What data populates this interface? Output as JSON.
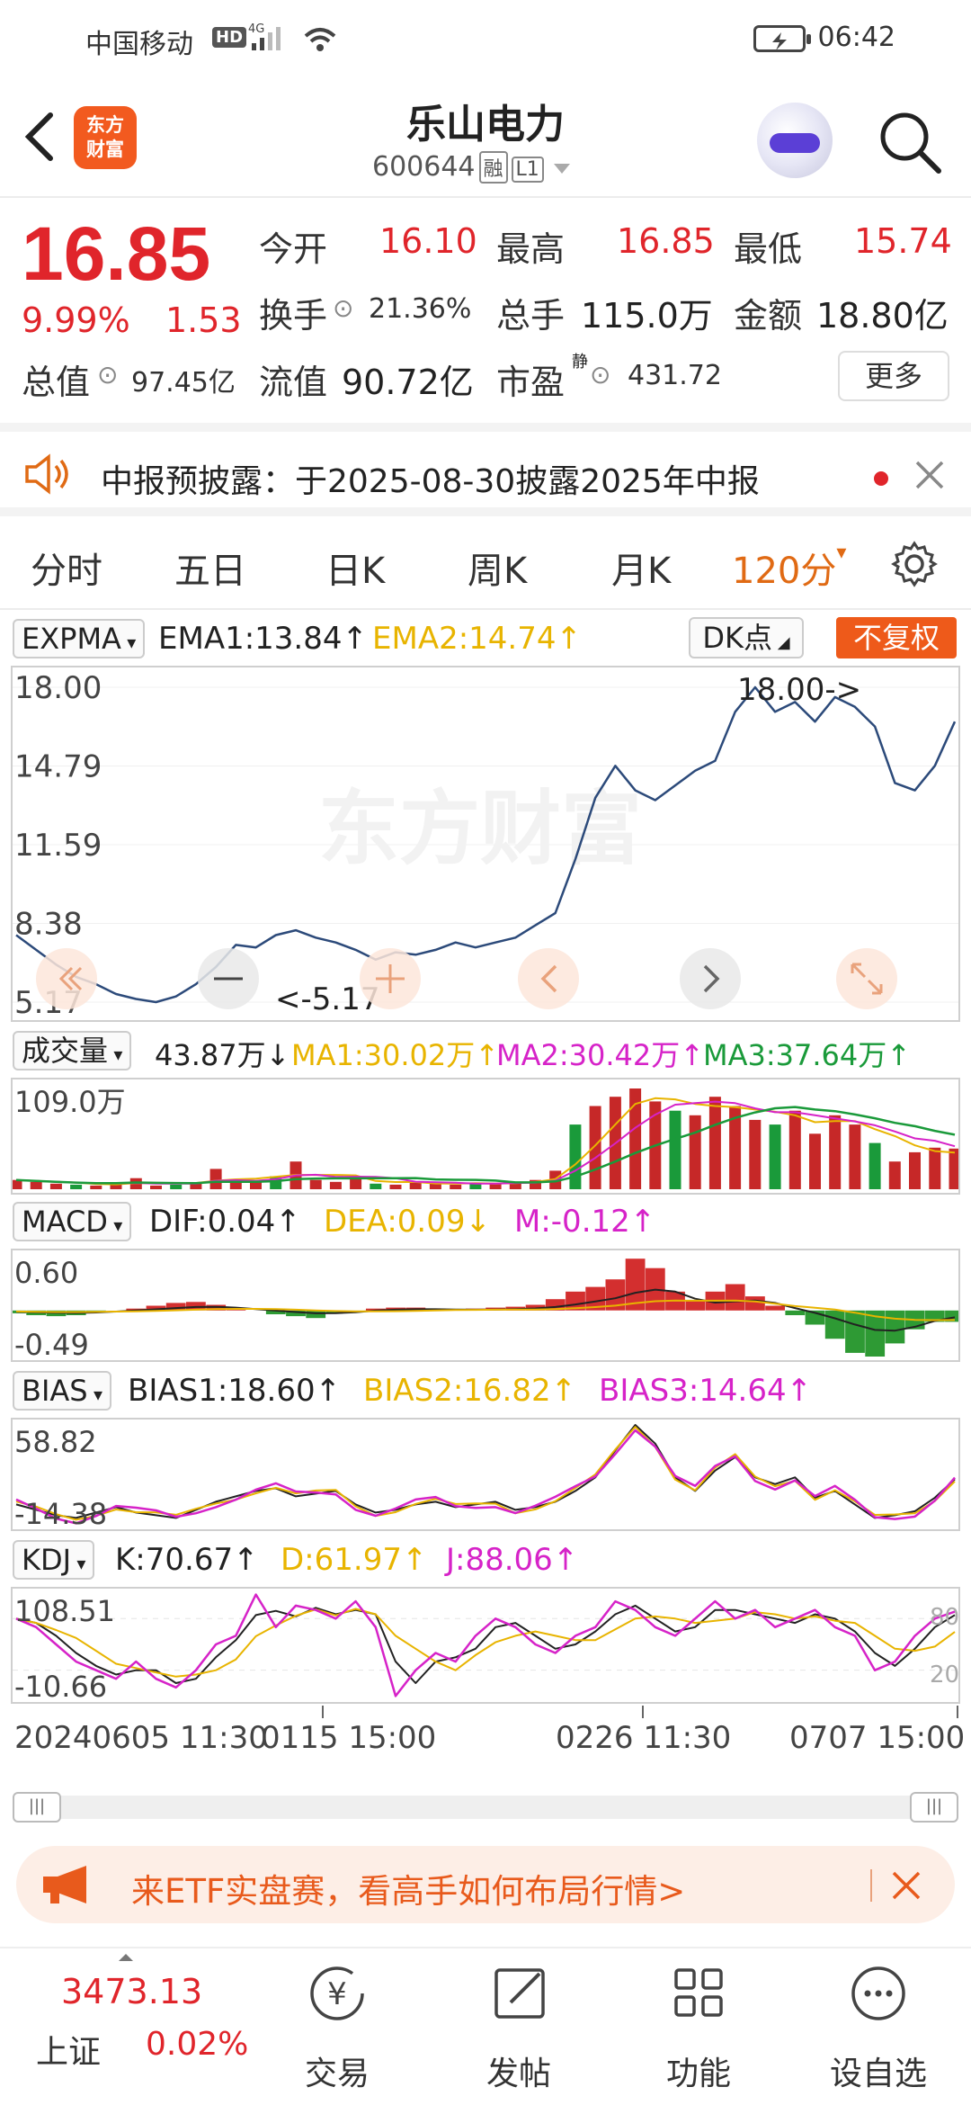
{
  "status_bar": {
    "carrier": "中国移动",
    "hd": "HD",
    "net": "4G",
    "time": "06:42"
  },
  "header": {
    "title": "乐山电力",
    "code": "600644",
    "tag_margin": "融",
    "tag_level": "L1",
    "logo_line1": "东方",
    "logo_line2": "财富"
  },
  "quote": {
    "price": "16.85",
    "change_pct": "9.99%",
    "change": "1.53",
    "open_label": "今开",
    "open": "16.10",
    "high_label": "最高",
    "high": "16.85",
    "low_label": "最低",
    "low": "15.74",
    "turnover_label": "换手",
    "turnover": "21.36%",
    "volume_label": "总手",
    "volume": "115.0万",
    "amount_label": "金额",
    "amount": "18.80亿",
    "mcap_label": "总值",
    "mcap": "97.45亿",
    "float_label": "流值",
    "float_cap": "90.72亿",
    "pe_label": "市盈",
    "pe_sup": "静",
    "pe": "431.72",
    "more": "更多"
  },
  "notice": {
    "text": "中报预披露：于2025-08-30披露2025年中报"
  },
  "tabs": [
    {
      "label": "分时"
    },
    {
      "label": "五日"
    },
    {
      "label": "日K"
    },
    {
      "label": "周K"
    },
    {
      "label": "月K"
    },
    {
      "label": "120分"
    }
  ],
  "main_panel": {
    "indicator": "EXPMA",
    "ema1": "EMA1:13.84↑",
    "ema2": "EMA2:14.74↑",
    "dk": "DK点",
    "unadjusted": "不复权",
    "y_labels": [
      "18.00",
      "14.79",
      "11.59",
      "8.38",
      "5.17"
    ],
    "max_marker": "18.00->",
    "min_marker": "<-5.17",
    "watermark": "东方财富"
  },
  "volume_panel": {
    "indicator": "成交量",
    "value": "43.87万↓",
    "ma1": "MA1:30.02万↑",
    "ma2": "MA2:30.42万↑",
    "ma3": "MA3:37.64万↑",
    "y_label": "109.0万"
  },
  "macd_panel": {
    "indicator": "MACD",
    "dif": "DIF:0.04↑",
    "dea": "DEA:0.09↓",
    "m": "M:-0.12↑",
    "y_top": "0.60",
    "y_bottom": "-0.49"
  },
  "bias_panel": {
    "indicator": "BIAS",
    "b1": "BIAS1:18.60↑",
    "b2": "BIAS2:16.82↑",
    "b3": "BIAS3:14.64↑",
    "y_top": "58.82",
    "y_bottom": "-14.38"
  },
  "kdj_panel": {
    "indicator": "KDJ",
    "k": "K:70.67↑",
    "d": "D:61.97↑",
    "j": "J:88.06↑",
    "y_top": "108.51",
    "y_bottom": "-10.66",
    "ref_high": "80",
    "ref_low": "20"
  },
  "time_axis": {
    "start": "20240605 11:30",
    "t2": "0115 15:00",
    "t3": "0226 11:30",
    "end": "0707 15:00"
  },
  "banner": {
    "text": "来ETF实盘赛，看高手如何布局行情>"
  },
  "bottom_nav": {
    "index_value": "3473.13",
    "index_name": "上证",
    "index_pct": "0.02%",
    "items": [
      {
        "label": "交易"
      },
      {
        "label": "发帖"
      },
      {
        "label": "功能"
      },
      {
        "label": "设自选"
      }
    ]
  },
  "colors": {
    "red": "#e0252b",
    "green": "#1a9a3a",
    "orange": "#e06a14",
    "navy": "#2c4a7a",
    "gold": "#e8b400",
    "magenta": "#d623c8"
  },
  "chart_data": [
    {
      "type": "line",
      "title": "EXPMA",
      "series": [
        {
          "name": "EXPMA",
          "values": [
            7.9,
            7.3,
            6.7,
            6.2,
            5.9,
            5.5,
            5.3,
            5.17,
            5.4,
            5.9,
            6.6,
            7.5,
            7.4,
            7.9,
            8.1,
            7.8,
            7.6,
            7.3,
            6.9,
            7.2,
            7.1,
            7.3,
            7.6,
            7.4,
            7.6,
            7.8,
            8.3,
            8.8,
            11.0,
            13.5,
            14.8,
            13.8,
            13.4,
            14.0,
            14.6,
            15.0,
            17.0,
            18.0,
            17.0,
            17.4,
            16.6,
            17.6,
            17.2,
            16.4,
            14.1,
            13.8,
            14.8,
            16.6
          ]
        }
      ],
      "ylim": [
        5.17,
        18.0
      ]
    },
    {
      "type": "bar",
      "title": "成交量",
      "series": [
        {
          "name": "成交量",
          "values": [
            10,
            8,
            6,
            5,
            4,
            6,
            12,
            4,
            5,
            6,
            22,
            10,
            8,
            14,
            30,
            10,
            8,
            12,
            6,
            5,
            8,
            6,
            5,
            7,
            6,
            8,
            10,
            20,
            70,
            90,
            100,
            109,
            95,
            85,
            80,
            100,
            90,
            75,
            70,
            85,
            60,
            80,
            70,
            50,
            30,
            40,
            45,
            44
          ]
        }
      ],
      "ylim": [
        0,
        109.0
      ]
    },
    {
      "type": "bar",
      "title": "MACD",
      "series": [
        {
          "name": "M",
          "values": [
            -0.03,
            -0.05,
            -0.06,
            -0.05,
            -0.02,
            0.0,
            0.02,
            0.05,
            0.08,
            0.09,
            0.06,
            0.03,
            0.0,
            -0.04,
            -0.06,
            -0.08,
            -0.03,
            0.0,
            0.02,
            0.03,
            0.03,
            0.02,
            0.01,
            0.02,
            0.03,
            0.04,
            0.06,
            0.12,
            0.2,
            0.25,
            0.33,
            0.55,
            0.45,
            0.2,
            0.1,
            0.2,
            0.28,
            0.15,
            0.05,
            -0.05,
            -0.15,
            -0.3,
            -0.45,
            -0.49,
            -0.35,
            -0.2,
            -0.12,
            -0.12
          ]
        }
      ],
      "ylim": [
        -0.49,
        0.6
      ]
    },
    {
      "type": "line",
      "title": "BIAS",
      "series": [
        {
          "name": "BIAS1",
          "values": [
            0,
            -4,
            -8,
            -10,
            -6,
            -2,
            -6,
            -8,
            -10,
            -4,
            2,
            6,
            10,
            12,
            6,
            8,
            10,
            0,
            -6,
            -4,
            0,
            2,
            -2,
            0,
            2,
            -4,
            -2,
            2,
            10,
            20,
            40,
            58.8,
            45,
            20,
            10,
            25,
            35,
            20,
            15,
            20,
            5,
            10,
            0,
            -10,
            -8,
            -5,
            5,
            18.6
          ]
        }
      ],
      "ylim": [
        -14.38,
        58.82
      ]
    },
    {
      "type": "line",
      "title": "KDJ",
      "series": [
        {
          "name": "KDJ",
          "values": [
            80,
            70,
            50,
            30,
            20,
            10,
            30,
            10,
            0,
            20,
            50,
            60,
            108,
            70,
            95,
            90,
            80,
            100,
            70,
            -10,
            20,
            40,
            30,
            60,
            80,
            70,
            50,
            40,
            60,
            70,
            100,
            90,
            70,
            60,
            80,
            100,
            80,
            90,
            70,
            80,
            90,
            70,
            60,
            20,
            30,
            60,
            80,
            88
          ]
        }
      ],
      "ylim": [
        -10.66,
        108.51
      ]
    }
  ]
}
